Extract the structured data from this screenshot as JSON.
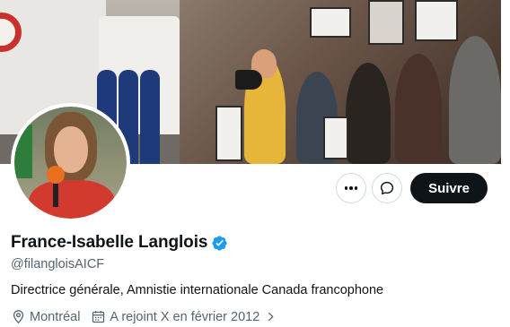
{
  "banner": {
    "description_icon": "banner-photo"
  },
  "avatar": {
    "icon": "profile-photo"
  },
  "actions": {
    "more_icon": "more-icon",
    "message_icon": "message-icon",
    "follow_label": "Suivre"
  },
  "profile": {
    "name": "France-Isabelle Langlois",
    "verified_icon": "verified-badge-icon",
    "handle": "@filangloisAICF",
    "bio": "Directrice générale, Amnistie internationale Canada francophone",
    "location": "Montréal",
    "joined": "A rejoint X en février 2012"
  },
  "colors": {
    "primary_text": "#0f1419",
    "secondary_text": "#536471",
    "verified_blue": "#1d9bf0",
    "button_dark": "#0f1419",
    "border": "#cfd9de"
  }
}
